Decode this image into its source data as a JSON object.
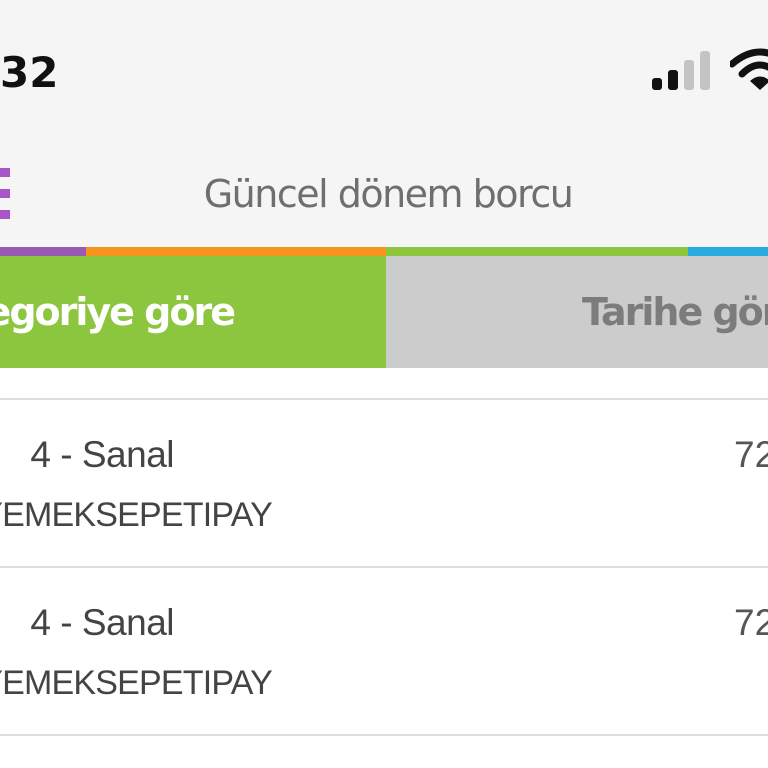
{
  "status_bar": {
    "time": "32",
    "signal_icon": "cellular-signal-icon",
    "wifi_icon": "wifi-icon"
  },
  "header": {
    "title": "Güncel dönem borcu",
    "menu_icon": "hamburger-menu-icon"
  },
  "colors": {
    "strip": [
      "#9b59b6",
      "#f7941d",
      "#8cc63f",
      "#29abe2"
    ],
    "active_tab_bg": "#8cc63f",
    "inactive_tab_bg": "#cccccc",
    "menu_icon": "#a855c7"
  },
  "tabs": [
    {
      "label": "Kategoriye göre",
      "active": true
    },
    {
      "label": "Tarihe göre",
      "active": false
    }
  ],
  "transactions": [
    {
      "line1": "4 - Sanal",
      "line2": "YEMEKSEPETIPAY",
      "amount": "72"
    },
    {
      "line1": "4 - Sanal",
      "line2": "YEMEKSEPETIPAY",
      "amount": "72"
    }
  ]
}
